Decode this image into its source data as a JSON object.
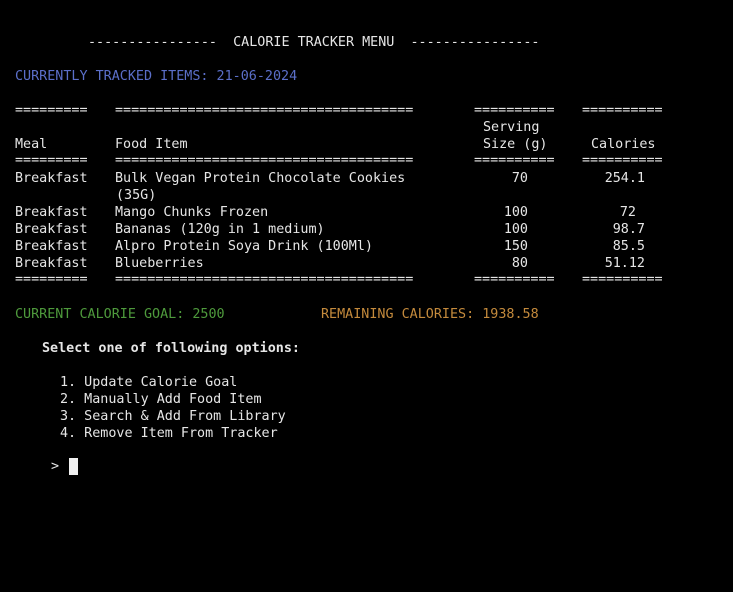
{
  "menu_title": "----------------  CALORIE TRACKER MENU  ----------------",
  "tracked_heading": "CURRENTLY TRACKED ITEMS: 21-06-2024",
  "table": {
    "rule_meal": "=========",
    "rule_food": "=====================================",
    "rule_serving": "==========",
    "rule_calories": "==========",
    "headers": {
      "meal": "Meal",
      "food": "Food Item",
      "serving_line1": "Serving",
      "serving_line2": "Size (g)",
      "calories": "Calories"
    },
    "rows": [
      {
        "meal": "Breakfast",
        "food": "Bulk Vegan Protein Chocolate Cookies",
        "food_cont": "(35G)",
        "serving": "70",
        "calories": "254.1"
      },
      {
        "meal": "Breakfast",
        "food": "Mango Chunks Frozen",
        "serving": "100",
        "calories": "72"
      },
      {
        "meal": "Breakfast",
        "food": "Bananas (120g in 1 medium)",
        "serving": "100",
        "calories": "98.7"
      },
      {
        "meal": "Breakfast",
        "food": "Alpro Protein Soya Drink (100Ml)",
        "serving": "150",
        "calories": "85.5"
      },
      {
        "meal": "Breakfast",
        "food": "Blueberries",
        "serving": "80",
        "calories": "51.12"
      }
    ]
  },
  "goal_text": "CURRENT CALORIE GOAL: 2500",
  "remaining_text": "REMAINING CALORIES: 1938.58",
  "options_prompt": "Select one of following options:",
  "options": [
    "1. Update Calorie Goal",
    "2. Manually Add Food Item",
    "3. Search & Add From Library",
    "4. Remove Item From Tracker"
  ],
  "input_prompt": ">",
  "colors": {
    "tracked": "#5b6fc9",
    "goal": "#4e9a3c",
    "remaining": "#c48a3c"
  }
}
